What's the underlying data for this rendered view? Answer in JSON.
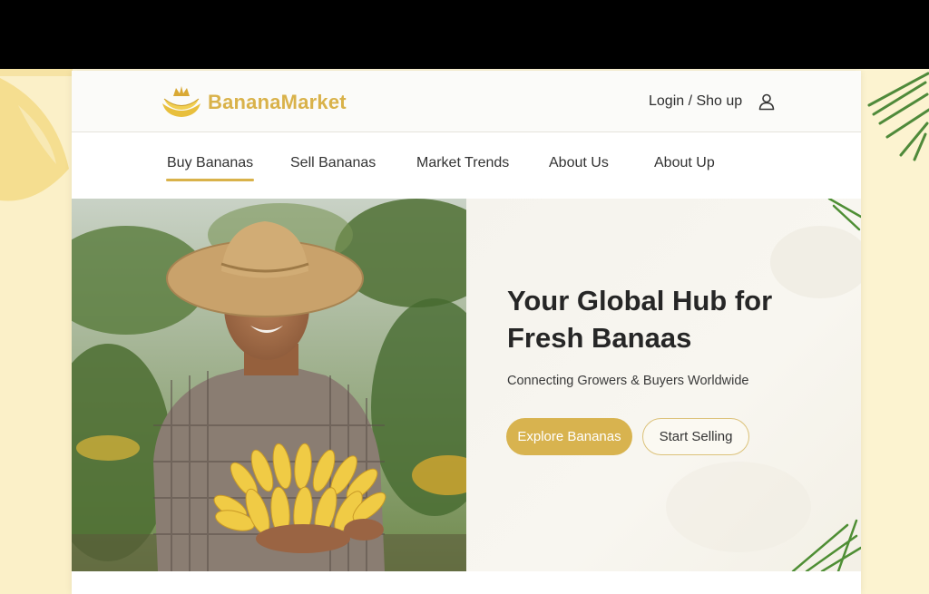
{
  "brand": {
    "name": "BananaMarket",
    "color": "#d9b24a"
  },
  "header": {
    "login_label": "Login / Sho up",
    "user_icon": "user-icon"
  },
  "nav": {
    "items": [
      {
        "label": "Buy Bananas",
        "active": true
      },
      {
        "label": "Sell Bananas",
        "active": false
      },
      {
        "label": "Market Trends",
        "active": false
      },
      {
        "label": "About Us",
        "active": false
      },
      {
        "label": "About Up",
        "active": false
      }
    ]
  },
  "hero": {
    "title": "Your Global Hub for\nFresh Banaas",
    "subtitle": "Connecting Growers & Buyers Worldwide",
    "primary_button": "Explore Bananas",
    "secondary_button": "Start Selling",
    "accent_color": "#d8b34f"
  }
}
